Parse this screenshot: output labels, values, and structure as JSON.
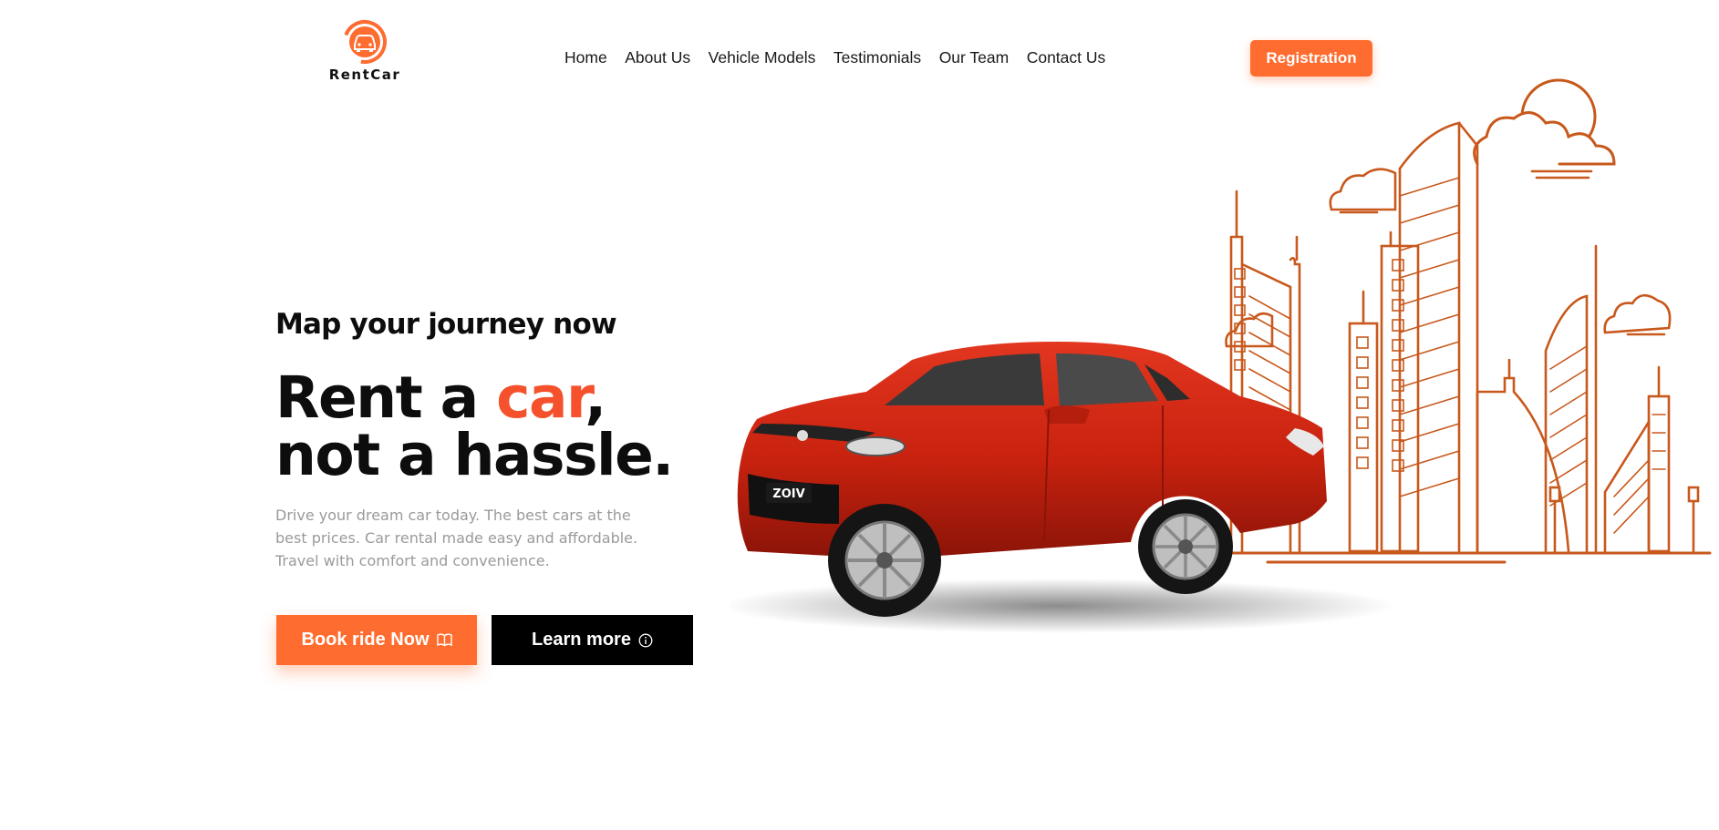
{
  "brand": {
    "name_part1": "Rent",
    "name_part2": "Car",
    "accent_color": "#ff6c2f"
  },
  "nav": {
    "items": [
      "Home",
      "About Us",
      "Vehicle Models",
      "Testimonials",
      "Our Team",
      "Contact Us"
    ]
  },
  "header": {
    "registration_label": "Registration"
  },
  "hero": {
    "subtitle": "Map your journey now",
    "title_part1": "Rent a ",
    "title_accent": "car",
    "title_part2": ",",
    "title_line2": "not a hassle.",
    "description": "Drive your dream car today. The best cars at the best prices. Car rental made easy and affordable. Travel with comfort and convenience.",
    "book_label": "Book ride Now",
    "learn_label": "Learn more",
    "plate_text": "ZOIV"
  },
  "icons": {
    "book": "book-icon",
    "info": "info-icon",
    "logo": "car-logo-icon"
  }
}
